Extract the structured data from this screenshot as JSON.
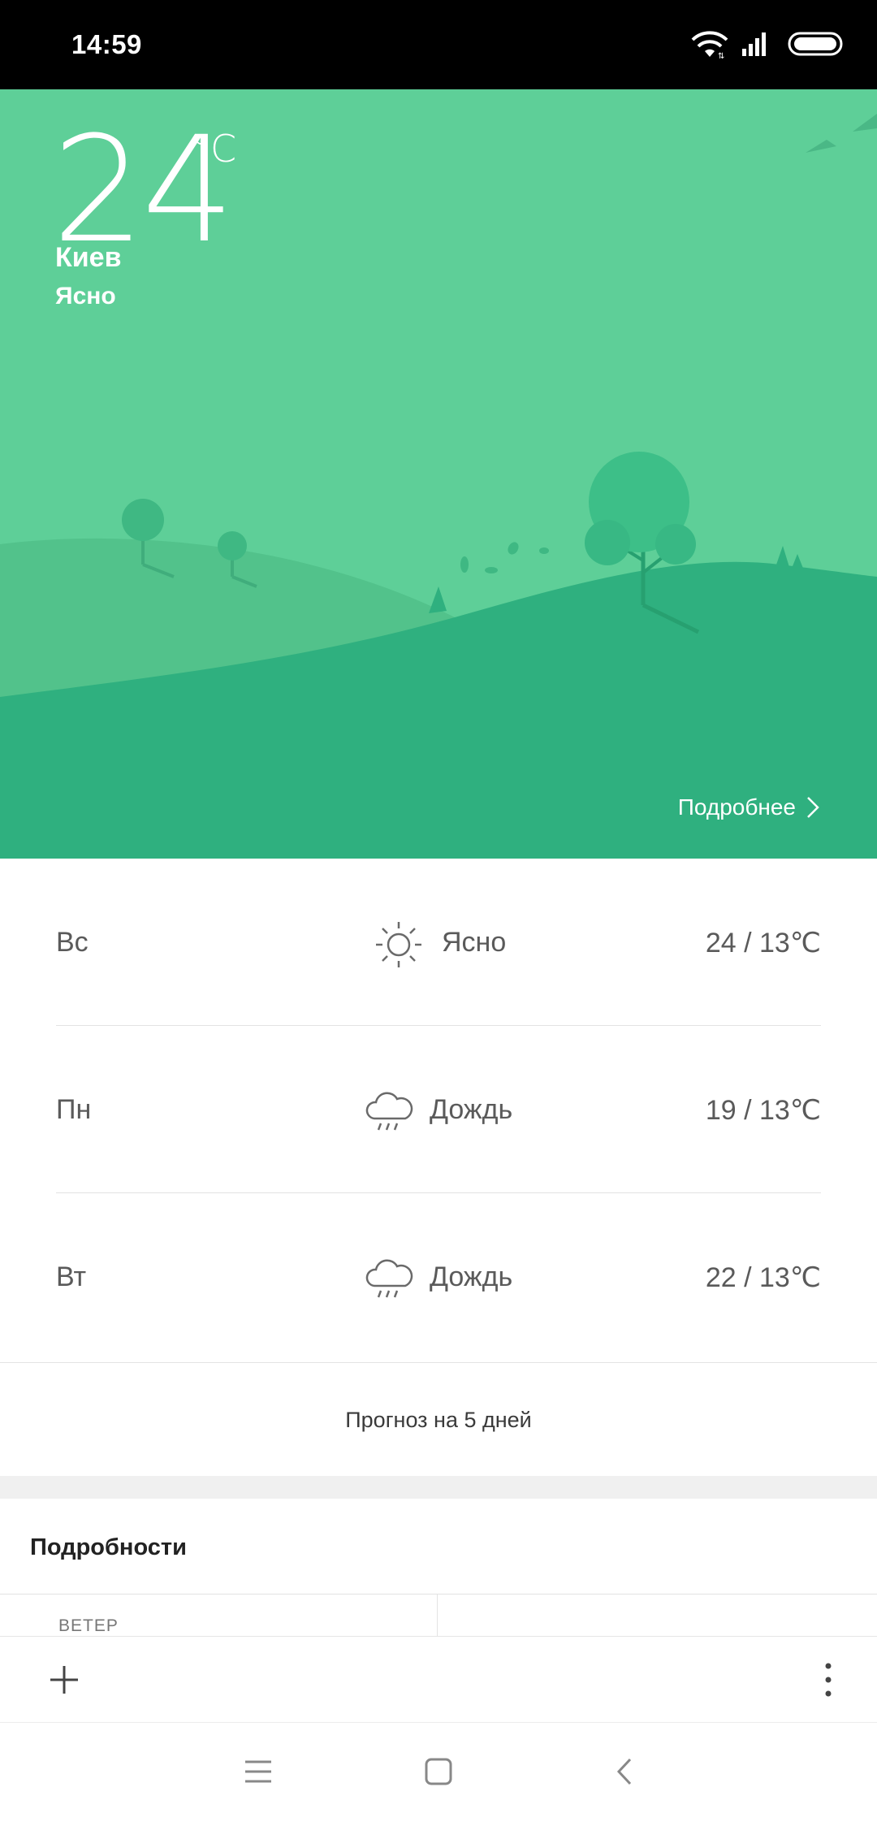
{
  "status_bar": {
    "time": "14:59"
  },
  "current": {
    "temperature": "24",
    "unit": "°C",
    "city": "Киев",
    "condition": "Ясно",
    "details_link": "Подробнее"
  },
  "forecast": [
    {
      "day": "Вс",
      "icon": "sun-icon",
      "condition": "Ясно",
      "temp": "24 / 13℃"
    },
    {
      "day": "Пн",
      "icon": "rain-cloud-icon",
      "condition": "Дождь",
      "temp": "19 / 13℃"
    },
    {
      "day": "Вт",
      "icon": "rain-cloud-icon",
      "condition": "Дождь",
      "temp": "22 / 13℃"
    }
  ],
  "forecast_more": "Прогноз на 5 дней",
  "details": {
    "title": "Подробности",
    "wind_label": "ВЕТЕР"
  },
  "colors": {
    "hero_sky": "#5ecf98",
    "hill_far": "#52c28b",
    "hill_near": "#2fb07f",
    "text_secondary": "#5a5a5a"
  }
}
